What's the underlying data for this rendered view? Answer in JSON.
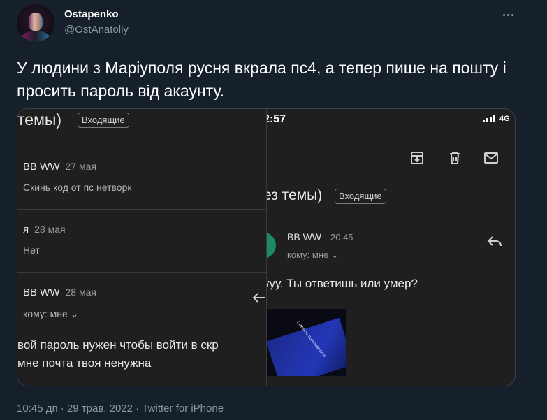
{
  "tweet": {
    "display_name": "Ostapenko",
    "handle": "@OstAnatoliy",
    "text": "У людини з Маріуполя русня вкрала пс4, а тепер пише на пошту і просить пароль від акаунту.",
    "meta": "10:45 дп · 29 трав. 2022 · Twitter for iPhone",
    "more_icon": "more-horizontal-icon"
  },
  "left_screenshot": {
    "subject_fragment": "темы)",
    "label_chip": "Входящие",
    "messages": [
      {
        "sender": "BB WW",
        "date": "27 мая",
        "preview": "Скинь код от пс нетворк"
      },
      {
        "sender": "я",
        "date": "28 мая",
        "preview": "Нет"
      },
      {
        "sender": "BB WW",
        "date": "28 мая",
        "to": "кому: мне ⌄"
      }
    ],
    "body_lines": [
      "вой  пароль нужен чтобы войти в скр",
      "мне почта твоя ненужна"
    ]
  },
  "right_screenshot": {
    "time": "2:57",
    "network": "4G",
    "toolbar_icons": [
      "archive-icon",
      "delete-icon",
      "mail-icon"
    ],
    "subject_fragment": "ез темы)",
    "label_chip": "Входящие",
    "sender": "BB WW",
    "time_sent": "20:45",
    "to": "кому: мне ⌄",
    "body": "ууу. Ты ответишь или умер?",
    "attachment_text": "Сменить пользователя"
  }
}
